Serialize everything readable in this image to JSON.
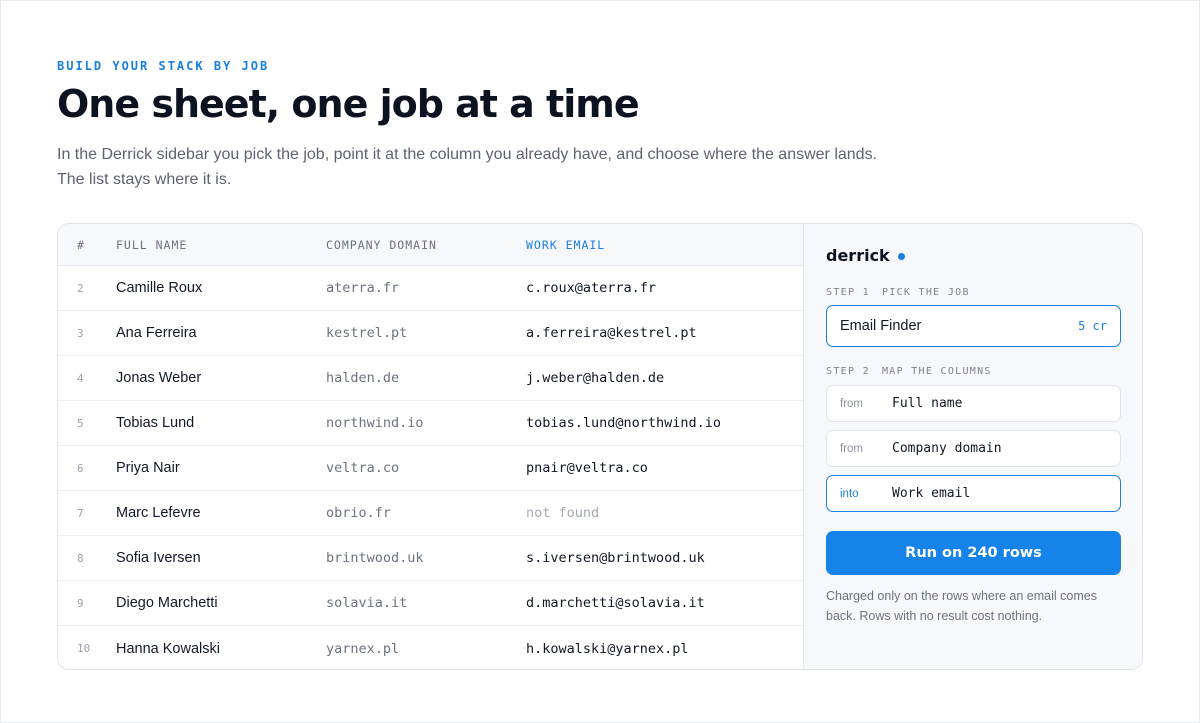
{
  "header": {
    "eyebrow": "BUILD YOUR STACK BY JOB",
    "title": "One sheet, one job at a time",
    "subtitle": "In the Derrick sidebar you pick the job, point it at the column you already have, and choose where the answer lands. The list stays where it is."
  },
  "table": {
    "columns": [
      "#",
      "FULL NAME",
      "COMPANY DOMAIN",
      "WORK EMAIL"
    ],
    "rows": [
      {
        "num": "2",
        "name": "Camille Roux",
        "domain": "aterra.fr",
        "email": "c.roux@aterra.fr"
      },
      {
        "num": "3",
        "name": "Ana Ferreira",
        "domain": "kestrel.pt",
        "email": "a.ferreira@kestrel.pt"
      },
      {
        "num": "4",
        "name": "Jonas Weber",
        "domain": "halden.de",
        "email": "j.weber@halden.de"
      },
      {
        "num": "5",
        "name": "Tobias Lund",
        "domain": "northwind.io",
        "email": "tobias.lund@northwind.io"
      },
      {
        "num": "6",
        "name": "Priya Nair",
        "domain": "veltra.co",
        "email": "pnair@veltra.co"
      },
      {
        "num": "7",
        "name": "Marc Lefevre",
        "domain": "obrio.fr",
        "email": "not found"
      },
      {
        "num": "8",
        "name": "Sofia Iversen",
        "domain": "brintwood.uk",
        "email": "s.iversen@brintwood.uk"
      },
      {
        "num": "9",
        "name": "Diego Marchetti",
        "domain": "solavia.it",
        "email": "d.marchetti@solavia.it"
      },
      {
        "num": "10",
        "name": "Hanna Kowalski",
        "domain": "yarnex.pl",
        "email": "h.kowalski@yarnex.pl"
      }
    ]
  },
  "sidebar": {
    "brand": "derrick",
    "step1": {
      "num": "STEP 1",
      "label": "PICK THE JOB"
    },
    "job": {
      "name": "Email Finder",
      "cost": "5 cr"
    },
    "step2": {
      "num": "STEP 2",
      "label": "MAP THE COLUMNS"
    },
    "mappings": [
      {
        "kind": "from",
        "column": "Full name"
      },
      {
        "kind": "from",
        "column": "Company domain"
      },
      {
        "kind": "into",
        "column": "Work email"
      }
    ],
    "run_label": "Run on 240 rows",
    "note": "Charged only on the rows where an email comes back. Rows with no result cost nothing."
  },
  "colors": {
    "accent": "#1a7fe0",
    "button": "#1583ea",
    "title": "#0b1220"
  }
}
